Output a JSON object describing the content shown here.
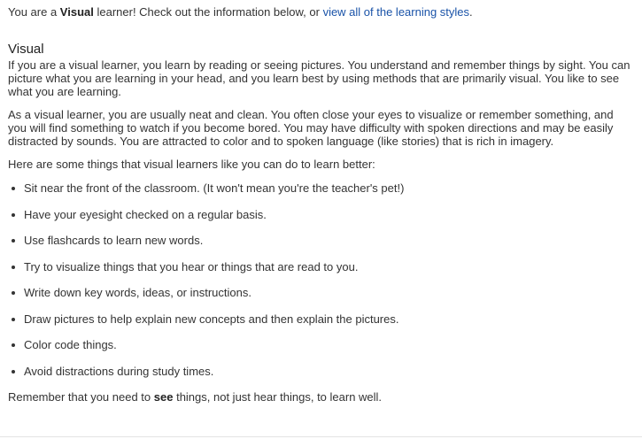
{
  "intro": {
    "prefix": "You are a ",
    "style": "Visual",
    "middle": " learner! Check out the information below, or ",
    "link": "view all of the learning styles",
    "suffix": "."
  },
  "section": {
    "heading": "Visual",
    "paragraphs": [
      "If you are a visual learner, you learn by reading or seeing pictures. You understand and remember things by sight. You can picture what you are learning in your head, and you learn best by using methods that are primarily visual. You like to see what you are learning.",
      "As a visual learner, you are usually neat and clean. You often close your eyes to visualize or remember something, and you will find something to watch if you become bored. You may have difficulty with spoken directions and may be easily distracted by sounds. You are attracted to color and to spoken language (like stories) that is rich in imagery."
    ],
    "lead": "Here are some things that visual learners like you can do to learn better:",
    "tips": [
      "Sit near the front of the classroom. (It won't mean you're the teacher's pet!)",
      "Have your eyesight checked on a regular basis.",
      "Use flashcards to learn new words.",
      "Try to visualize things that you hear or things that are read to you.",
      "Write down key words, ideas, or instructions.",
      "Draw pictures to help explain new concepts and then explain the pictures.",
      "Color code things.",
      "Avoid distractions during study times."
    ],
    "outro": {
      "prefix": "Remember that you need to ",
      "emphasis": "see",
      "suffix": " things, not just hear things, to learn well."
    }
  }
}
